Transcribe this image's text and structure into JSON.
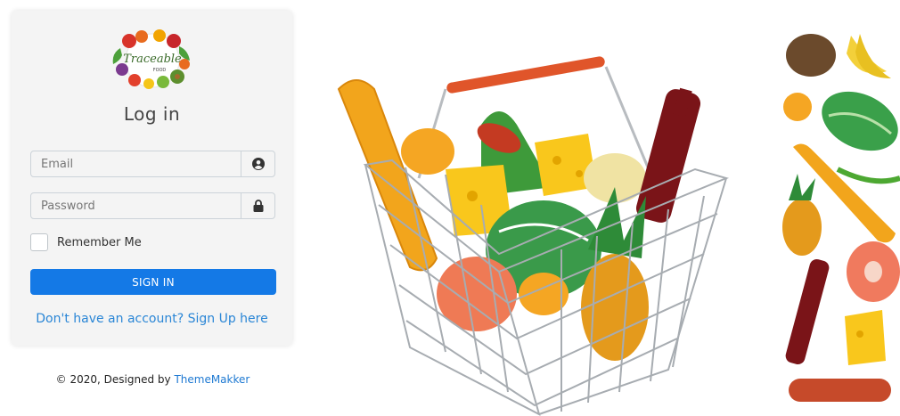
{
  "login": {
    "logo_text": "Traceable",
    "logo_subtext": "FOOD",
    "title": "Log in",
    "email_placeholder": "Email",
    "password_placeholder": "Password",
    "remember_label": "Remember Me",
    "signin_label": "SIGN IN",
    "signup_link": "Don't have an account? Sign Up here"
  },
  "footer": {
    "prefix": "© 2020, Designed by ",
    "brand": "ThemeMakker"
  },
  "icons": {
    "email": "user-circle-icon",
    "password": "lock-icon"
  },
  "colors": {
    "primary": "#1479e6",
    "link": "#2a86d6",
    "card_bg": "#f4f4f4"
  }
}
